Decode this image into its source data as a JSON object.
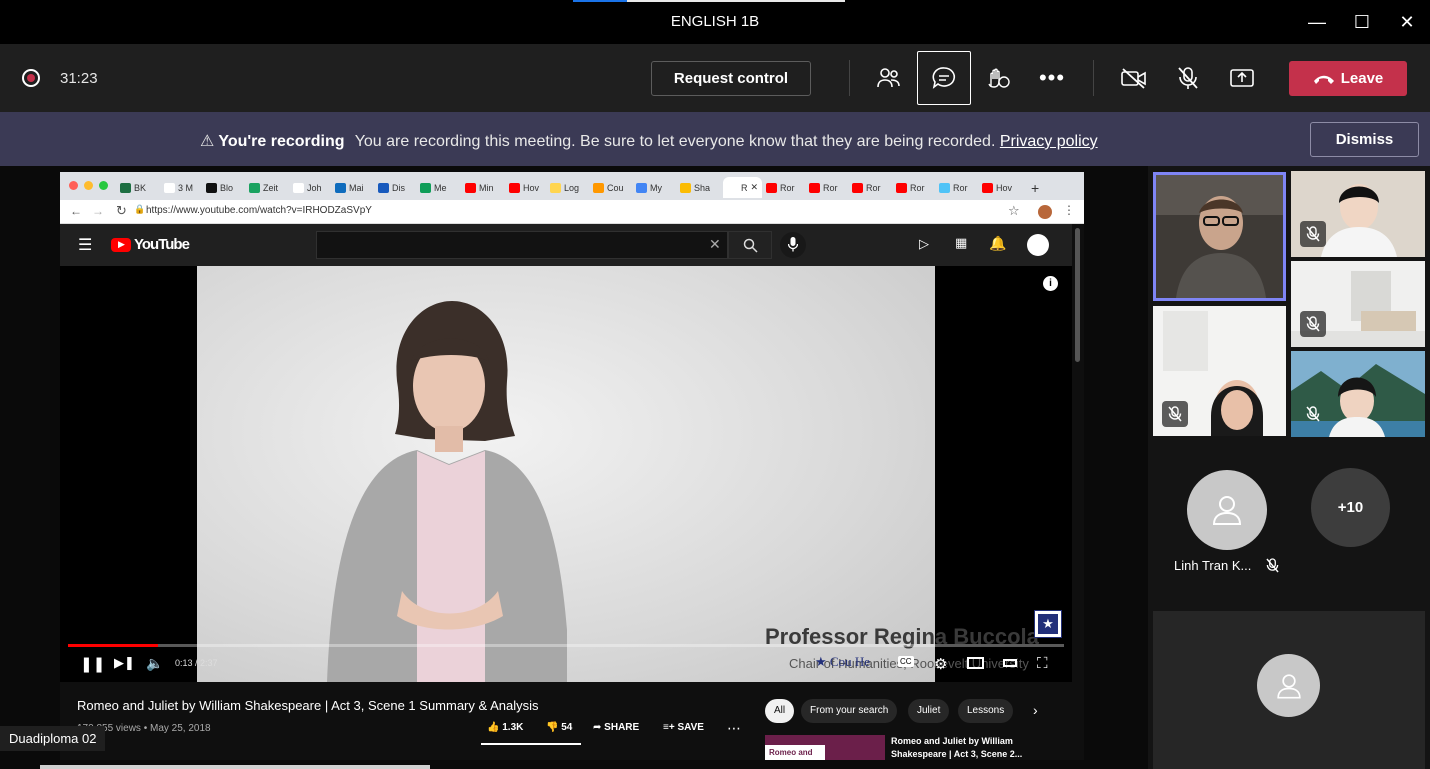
{
  "window": {
    "title": "ENGLISH 1B"
  },
  "toolbar": {
    "timer": "31:23",
    "request_control": "Request control",
    "leave": "Leave",
    "icons": [
      "people-icon",
      "chat-icon",
      "reactions-icon",
      "more-icon",
      "camera-off-icon",
      "mic-off-icon",
      "share-icon"
    ]
  },
  "banner": {
    "bold": "You're recording",
    "message": "You are recording this meeting. Be sure to let everyone know that they are being recorded.",
    "link": "Privacy policy",
    "dismiss": "Dismiss"
  },
  "browser": {
    "tabs": [
      "BK",
      "3 M",
      "Blo",
      "Zeit",
      "Joh",
      "Mai",
      "Dis",
      "Me",
      "Min",
      "Hov",
      "Log",
      "Cou",
      "My",
      "Sha",
      "R",
      "Ror",
      "Ror",
      "Ror",
      "Ror",
      "Ror",
      "Hov"
    ],
    "url": "https://www.youtube.com/watch?v=IRHODZaSVpY"
  },
  "youtube": {
    "logo": "YouTube",
    "video_overlay_name": "Professor Regina Buccola",
    "video_overlay_sub": "Chair of Humanities, Roosevelt University",
    "time": "0:13 / 2:37",
    "progress": 0.09,
    "brand": "Cou  He",
    "title": "Romeo and Juliet by William Shakespeare | Act 3, Scene 1 Summary & Analysis",
    "meta": "170,855 views • May 25, 2018",
    "likes": "1.3K",
    "dislikes": "54",
    "share": "SHARE",
    "save": "SAVE",
    "chips": [
      "All",
      "From your search",
      "Juliet",
      "Lessons"
    ],
    "rec_thumb": "Romeo and",
    "rec_title": "Romeo and Juliet by William Shakespeare | Act 3, Scene 2..."
  },
  "participants": {
    "linh_name": "Linh Tran K...",
    "overflow": "+10"
  },
  "presenter_label": "Duadiploma 02"
}
